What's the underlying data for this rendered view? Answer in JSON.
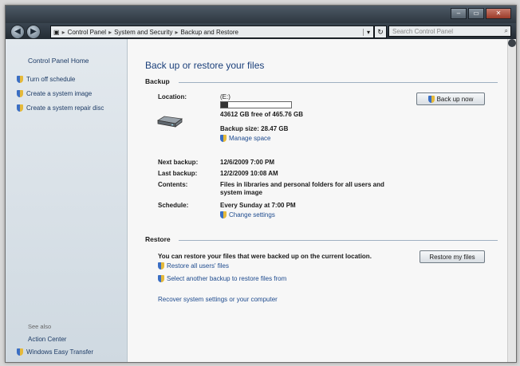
{
  "address": {
    "crumbs": [
      "Control Panel",
      "System and Security",
      "Backup and Restore"
    ],
    "search_placeholder": "Search Control Panel"
  },
  "window_controls": [
    "–",
    "▭",
    "✕"
  ],
  "sidebar": {
    "home": "Control Panel Home",
    "items": [
      {
        "label": "Turn off schedule"
      },
      {
        "label": "Create a system image"
      },
      {
        "label": "Create a system repair disc"
      }
    ],
    "see_also": "See also",
    "links": [
      {
        "label": "Action Center"
      },
      {
        "label": "Windows Easy Transfer"
      }
    ]
  },
  "main": {
    "title": "Back up or restore your files",
    "backup": {
      "heading": "Backup",
      "location_label": "Location:",
      "drive": "(E:)",
      "used_fraction": 0.1,
      "free_text": "43612 GB free of 465.76 GB",
      "backup_size": "Backup size: 28.47 GB",
      "manage_space": "Manage space",
      "back_up_now": "Back up now",
      "next_label": "Next backup:",
      "next_value": "12/6/2009 7:00 PM",
      "last_label": "Last backup:",
      "last_value": "12/2/2009 10:08 AM",
      "contents_label": "Contents:",
      "contents_value": "Files in libraries and personal folders for all users and system image",
      "schedule_label": "Schedule:",
      "schedule_value": "Every Sunday at 7:00 PM",
      "change_settings": "Change settings"
    },
    "restore": {
      "heading": "Restore",
      "text": "You can restore your files that were backed up on the current location.",
      "restore_my_files": "Restore my files",
      "restore_all_users": "Restore all users' files",
      "select_another": "Select another backup to restore files from",
      "recover_settings": "Recover system settings or your computer"
    }
  }
}
